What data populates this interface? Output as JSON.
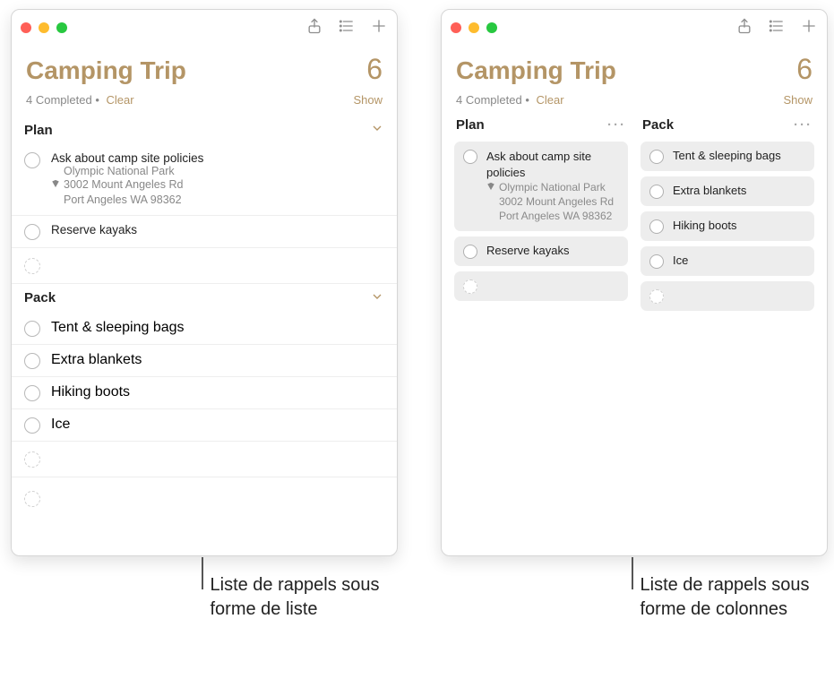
{
  "app": {
    "title": "Camping Trip",
    "count": "6",
    "completed_label": "4 Completed",
    "bullet": " • ",
    "clear_label": "Clear",
    "show_label": "Show"
  },
  "sections": {
    "plan": {
      "name": "Plan",
      "items": [
        {
          "title": "Ask about camp site policies",
          "subtitle": "Olympic National Park",
          "addr1": "3002 Mount Angeles Rd",
          "addr2": "Port Angeles WA 98362"
        },
        {
          "title": "Reserve kayaks"
        }
      ]
    },
    "pack": {
      "name": "Pack",
      "items": [
        {
          "title": "Tent & sleeping bags"
        },
        {
          "title": "Extra blankets"
        },
        {
          "title": "Hiking boots"
        },
        {
          "title": "Ice"
        }
      ]
    }
  },
  "callouts": {
    "list": "Liste de rappels sous forme de liste",
    "columns": "Liste de rappels sous forme de colonnes"
  },
  "icons": {
    "share": "share-icon",
    "list": "list-icon",
    "add": "plus-icon",
    "chevron": "chevron-down-icon",
    "location": "location-pin-icon",
    "more": "more-icon"
  }
}
